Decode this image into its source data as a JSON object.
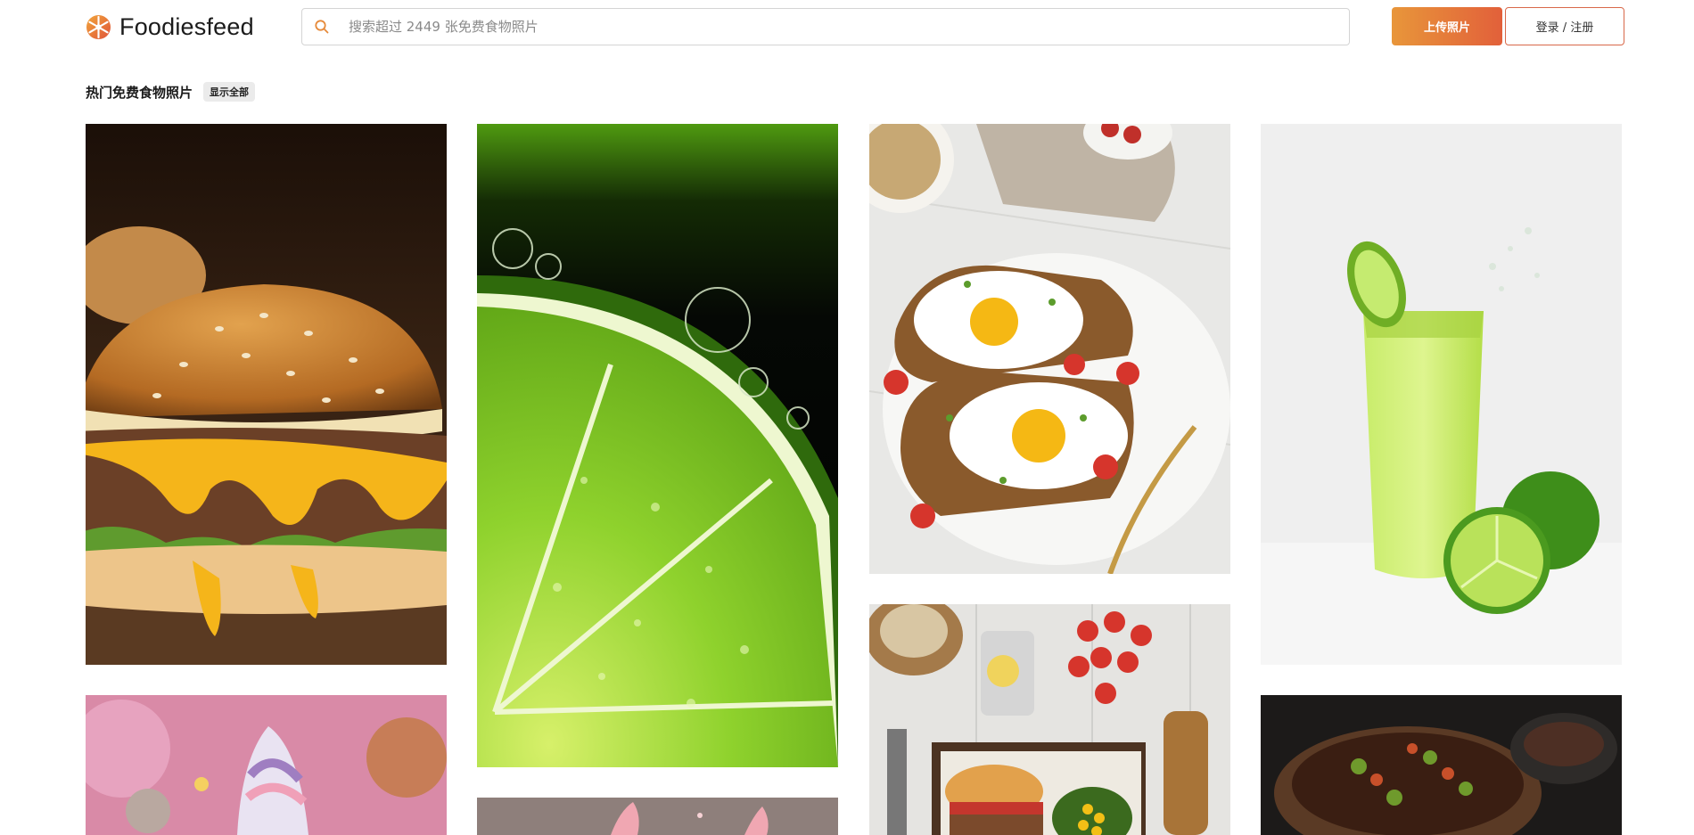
{
  "header": {
    "logo_text": "Foodiesfeed",
    "search": {
      "placeholder": "搜索超过 2449 张免费食物照片",
      "value": ""
    },
    "upload_label": "上传照片",
    "login_label": "登录 / 注册"
  },
  "section": {
    "title": "热门免费食物照片",
    "show_all_label": "显示全部"
  },
  "colors": {
    "accent_start": "#e8963a",
    "accent_end": "#e2603a",
    "login_border": "#d8694a"
  },
  "photos": [
    {
      "subject": "cheeseburger",
      "icon": "photo-burger"
    },
    {
      "subject": "lime slice with bubbles",
      "icon": "photo-lime"
    },
    {
      "subject": "fried eggs on avocado toast",
      "icon": "photo-eggs-toast"
    },
    {
      "subject": "lime juice glass",
      "icon": "photo-lime-juice"
    },
    {
      "subject": "ice cream cone",
      "icon": "photo-ice-cream"
    },
    {
      "subject": "splash dessert",
      "icon": "photo-splash"
    },
    {
      "subject": "burger tray with tomatoes",
      "icon": "photo-burger-tray"
    },
    {
      "subject": "bowl of stew",
      "icon": "photo-stew"
    }
  ]
}
